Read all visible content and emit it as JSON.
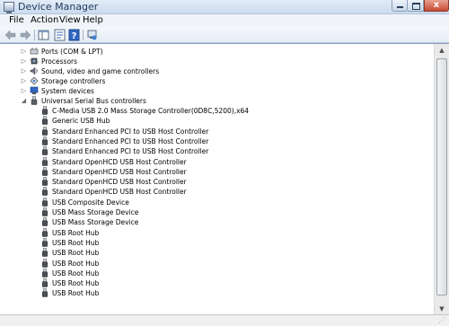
{
  "window": {
    "title": "Device Manager",
    "close_glyph": "x"
  },
  "menu": [
    "File",
    "Action",
    "View",
    "Help"
  ],
  "toolbar": [
    {
      "name": "back-icon"
    },
    {
      "name": "forward-icon"
    },
    {
      "name": "show-hide-console-tree-icon"
    },
    {
      "name": "properties-icon"
    },
    {
      "name": "help-icon"
    },
    {
      "name": "show-hidden-icon"
    }
  ],
  "tree": {
    "categories": [
      {
        "label": "Ports (COM & LPT)",
        "icon": "port-icon",
        "expanded": false
      },
      {
        "label": "Processors",
        "icon": "processor-icon",
        "expanded": false
      },
      {
        "label": "Sound, video and game controllers",
        "icon": "sound-icon",
        "expanded": false
      },
      {
        "label": "Storage controllers",
        "icon": "storage-icon",
        "expanded": false
      },
      {
        "label": "System devices",
        "icon": "system-icon",
        "expanded": false
      },
      {
        "label": "Universal Serial Bus controllers",
        "icon": "usb-icon",
        "expanded": true
      }
    ],
    "usb_devices": [
      "C-Media USB 2.0 Mass Storage Controller(0D8C,5200),x64",
      "Generic USB Hub",
      "Standard Enhanced PCI to USB Host Controller",
      "Standard Enhanced PCI to USB Host Controller",
      "Standard Enhanced PCI to USB Host Controller",
      "Standard OpenHCD USB Host Controller",
      "Standard OpenHCD USB Host Controller",
      "Standard OpenHCD USB Host Controller",
      "Standard OpenHCD USB Host Controller",
      "USB Composite Device",
      "USB Mass Storage Device",
      "USB Mass Storage Device",
      "USB Root Hub",
      "USB Root Hub",
      "USB Root Hub",
      "USB Root Hub",
      "USB Root Hub",
      "USB Root Hub",
      "USB Root Hub"
    ]
  },
  "scrollbar": {
    "up_glyph": "▲",
    "down_glyph": "▼"
  },
  "colors": {
    "title_text": "#1e395b",
    "tree_background": "#ffffff",
    "expander_glyph": "#6d6d6d"
  }
}
